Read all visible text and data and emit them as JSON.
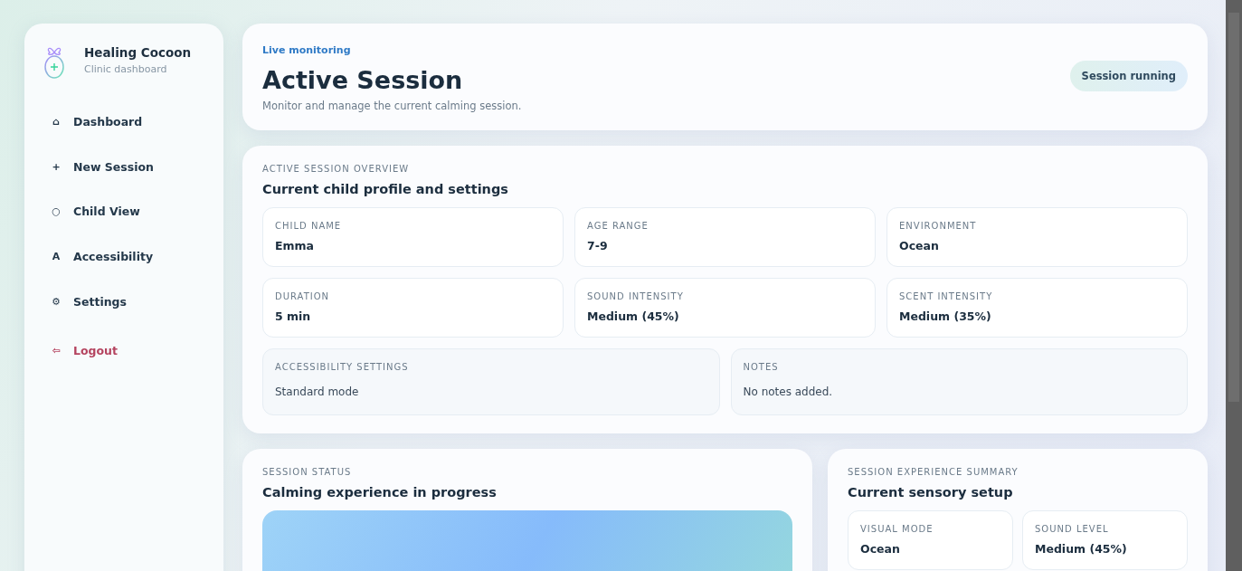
{
  "brand": {
    "name": "Healing Cocoon",
    "subtitle": "Clinic dashboard"
  },
  "nav": [
    {
      "icon": "⌂",
      "label": "Dashboard",
      "kind": "normal"
    },
    {
      "icon": "+",
      "label": "New Session",
      "kind": "normal"
    },
    {
      "icon": "○",
      "label": "Child View",
      "kind": "normal"
    },
    {
      "icon": "A",
      "label": "Accessibility",
      "kind": "normal"
    },
    {
      "icon": "⚙",
      "label": "Settings",
      "kind": "normal"
    },
    {
      "icon": "⇦",
      "label": "Logout",
      "kind": "danger"
    }
  ],
  "header": {
    "eyebrow": "Live monitoring",
    "title": "Active Session",
    "subtitle": "Monitor and manage the current calming session.",
    "badge": "Session running"
  },
  "overview": {
    "eyebrow": "ACTIVE SESSION OVERVIEW",
    "title": "Current child profile and settings",
    "fields": [
      {
        "label": "CHILD NAME",
        "value": "Emma"
      },
      {
        "label": "AGE RANGE",
        "value": "7-9"
      },
      {
        "label": "ENVIRONMENT",
        "value": "Ocean"
      },
      {
        "label": "DURATION",
        "value": "5 min"
      },
      {
        "label": "SOUND INTENSITY",
        "value": "Medium (45%)"
      },
      {
        "label": "SCENT INTENSITY",
        "value": "Medium (35%)"
      }
    ],
    "wide_fields": [
      {
        "label": "ACCESSIBILITY SETTINGS",
        "value": "Standard mode"
      },
      {
        "label": "NOTES",
        "value": "No notes added."
      }
    ]
  },
  "status": {
    "eyebrow": "SESSION STATUS",
    "title": "Calming experience in progress"
  },
  "summary": {
    "eyebrow": "SESSION EXPERIENCE SUMMARY",
    "title": "Current sensory setup",
    "fields": [
      {
        "label": "VISUAL MODE",
        "value": "Ocean"
      },
      {
        "label": "SOUND LEVEL",
        "value": "Medium (45%)"
      }
    ]
  }
}
